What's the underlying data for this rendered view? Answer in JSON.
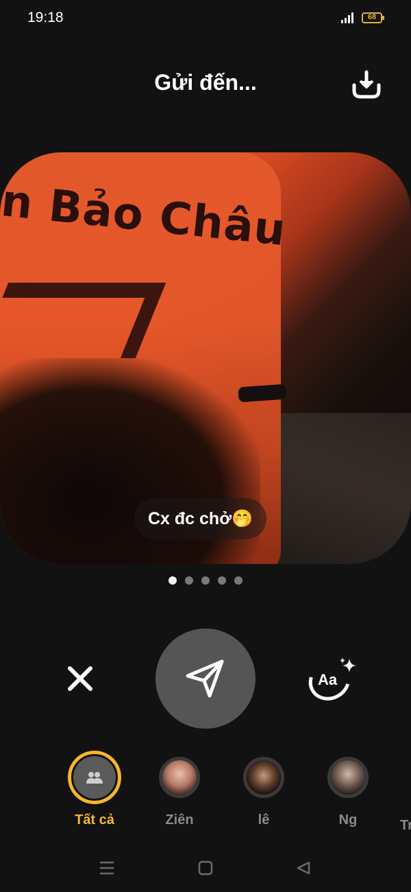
{
  "status_bar": {
    "time": "19:18",
    "battery": "68"
  },
  "header": {
    "title": "Gửi đến...",
    "download_icon": "download-icon"
  },
  "photo": {
    "shirt_text": "n Bảo Châu",
    "caption": "Cx đc chở🤭"
  },
  "pager": {
    "count": 5,
    "active_index": 0
  },
  "actions": {
    "cancel_icon": "close-icon",
    "send_icon": "send-icon",
    "text_style_label": "Aa",
    "text_style_icon": "text-style-sparkle-icon"
  },
  "friends": {
    "items": [
      {
        "name": "Tất cả",
        "selected": true
      },
      {
        "name": "Ziên",
        "selected": false
      },
      {
        "name": "lê",
        "selected": false
      },
      {
        "name": "Ng",
        "selected": false
      }
    ],
    "cut_off_name": "Tr"
  },
  "nav": {
    "menu_icon": "menu-icon",
    "home_icon": "home-icon",
    "back_icon": "back-icon"
  },
  "colors": {
    "background": "#121212",
    "accent": "#f5b82a",
    "send_button": "#555555"
  }
}
